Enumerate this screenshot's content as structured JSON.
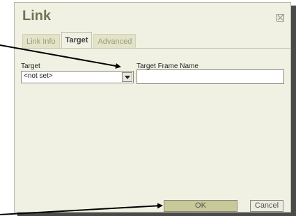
{
  "dialog": {
    "title": "Link",
    "tabs": [
      {
        "label": "Link Info",
        "active": false
      },
      {
        "label": "Target",
        "active": true
      },
      {
        "label": "Advanced",
        "active": false
      }
    ],
    "target": {
      "label": "Target",
      "selected_value": "<not set>"
    },
    "frame_name": {
      "label": "Target Frame Name",
      "value": ""
    },
    "buttons": {
      "ok_label": "OK",
      "cancel_label": "Cancel"
    }
  },
  "icons": {
    "close": "close-icon",
    "dropdown": "chevron-down-icon"
  },
  "colors": {
    "dialog_bg": "#f1f1e3",
    "title": "#737357",
    "ok_button": "#c8c898",
    "annotation_arrow": "#000000"
  }
}
